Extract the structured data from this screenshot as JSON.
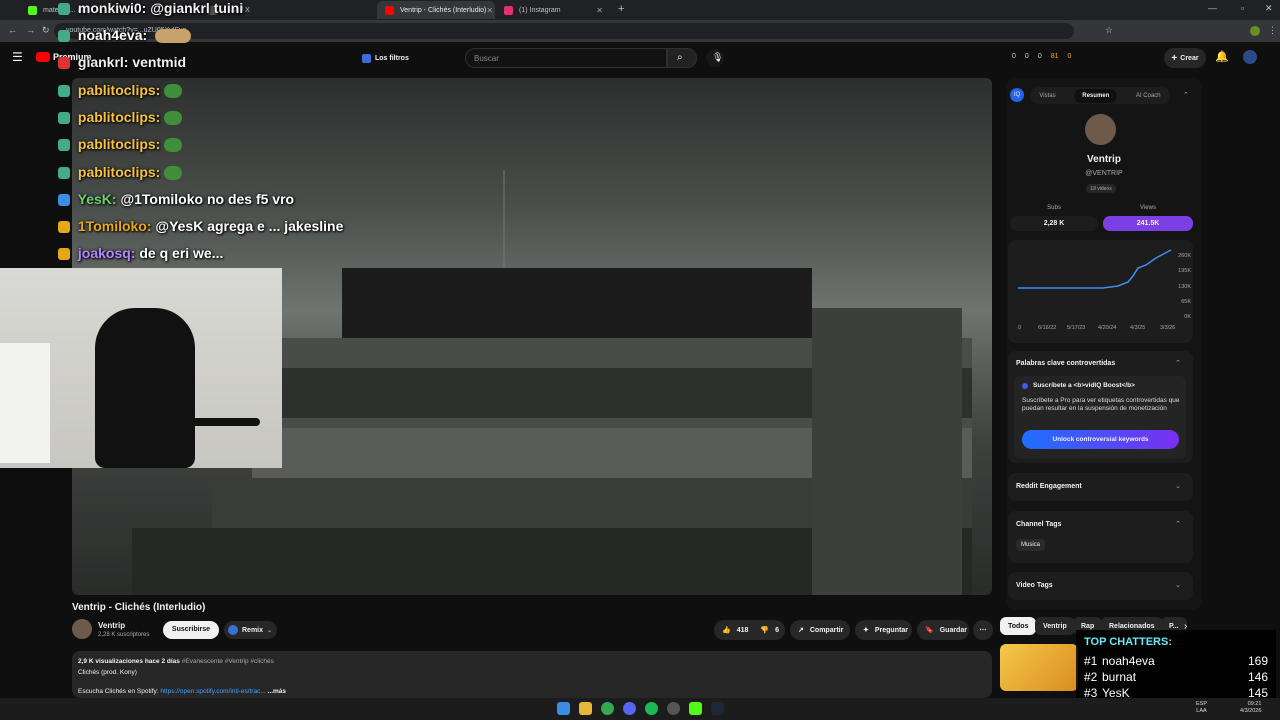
{
  "browser": {
    "tabs": [
      {
        "label": "matecap... actif",
        "favicon": "#53fc18"
      },
      {
        "label": "...icio / X",
        "favicon": "#888"
      },
      {
        "label": "Ventrip - Clichés (Interludio)",
        "favicon": "#ff0000"
      },
      {
        "label": "(1) Instagram",
        "favicon": "#e1306c"
      }
    ],
    "url": "youtube.com/watch?v=...uZU05XvIFyo"
  },
  "youtube": {
    "logo_text": "Premium",
    "filters_label": "Los filtros",
    "search_placeholder": "Buscar",
    "create_label": "Crear",
    "header_stats": [
      "0",
      "0",
      "0",
      "81",
      "0"
    ]
  },
  "chat": {
    "lines": [
      {
        "user": "monkiwi0:",
        "text": "@giankrl tuini",
        "color": "#ffffff"
      },
      {
        "user": "noah4eva:",
        "text": "",
        "color": "#ffffff"
      },
      {
        "user": "giankrl:",
        "text": "ventmid",
        "color": "#ffffff"
      },
      {
        "user": "pablitoclips:",
        "text": "",
        "color": "#f5c242"
      },
      {
        "user": "pablitoclips:",
        "text": "",
        "color": "#f5c242"
      },
      {
        "user": "pablitoclips:",
        "text": "",
        "color": "#f5c242"
      },
      {
        "user": "pablitoclips:",
        "text": "",
        "color": "#f5c242"
      },
      {
        "user": "YesK:",
        "text": "@1Tomiloko no des f5 vro",
        "color": "#6cd16c"
      },
      {
        "user": "1Tomiloko:",
        "text": "@YesK agrega e ... jakesline",
        "color": "#e6a817"
      },
      {
        "user": "joakosq:",
        "text": "de q eri we...",
        "color": "#b388ff"
      }
    ]
  },
  "video": {
    "title": "Ventrip - Clichés (Interludio)",
    "channel": "Ventrip",
    "subscribers": "2,28 K suscriptores",
    "subscribe_label": "Suscribirse",
    "remix_label": "Remix",
    "likes": "418",
    "dislikes": "6",
    "share_label": "Compartir",
    "ask_label": "Preguntar",
    "save_label": "Guardar",
    "views_line": "2,9 K visualizaciones  hace 2 días",
    "hashtags": "#Evanescente #Ventrip #clichés",
    "desc_line1": "Clichés (prod. Kony)",
    "desc_spotify_prefix": "Escucha Clichés en Spotify:",
    "desc_spotify_link": "https://open.spotify.com/intl-es/trac...",
    "more_label": "...más"
  },
  "vidiq": {
    "tabs": [
      "Vistas",
      "Resumen",
      "AI Coach"
    ],
    "channel_name": "Ventrip",
    "handle": "@VENTRIP",
    "videos_badge": "18 videos",
    "subs_label": "Subs",
    "subs_value": "2,28 K",
    "views_label": "Views",
    "views_value": "241.5K",
    "chart_yticks": [
      "260K",
      "195K",
      "130K",
      "65K",
      "0K"
    ],
    "chart_xticks": [
      "0",
      "6/16/22",
      "5/17/23",
      "4/20/24",
      "4/3/25",
      "3/3/26"
    ],
    "controversial_title": "Palabras clave controvertidas",
    "boost_title": "Suscríbete a <b>vidIQ Boost</b>",
    "boost_text": "Suscríbete a Pro para ver etiquetas controvertidas que puedan resultar en la suspensión de monetización",
    "unlock_label": "Unlock controversial keywords",
    "reddit_title": "Reddit Engagement",
    "channel_tags_title": "Channel Tags",
    "channel_tag": "Musica",
    "video_tags_title": "Video Tags"
  },
  "chips": [
    "Todos",
    "Ventrip",
    "Rap",
    "Relacionados",
    "P..."
  ],
  "top_chatters": {
    "title": "TOP CHATTERS:",
    "rows": [
      {
        "rank": "#1",
        "name": "noah4eva",
        "count": "169"
      },
      {
        "rank": "#2",
        "name": "burnat",
        "count": "146"
      },
      {
        "rank": "#3",
        "name": "YesK",
        "count": "145"
      }
    ]
  },
  "taskbar": {
    "lang": "ESP",
    "region": "LAA",
    "time": "09:21",
    "date": "4/3/2026"
  },
  "colors": {
    "accent_purple": "#7b3fe4",
    "unlock_gradient_start": "#1e6fff",
    "unlock_gradient_end": "#7a2ff0",
    "chart_line": "#3d8ff5"
  }
}
